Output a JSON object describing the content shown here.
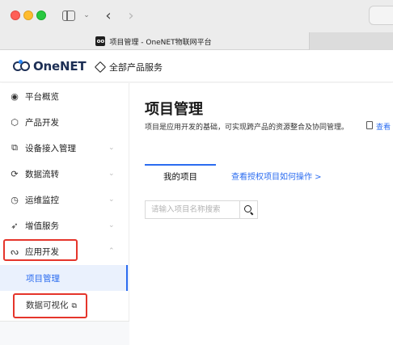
{
  "browser": {
    "tab_title": "项目管理 - OneNET物联网平台",
    "favicon_text": "oo"
  },
  "header": {
    "logo_text": "OneNET",
    "all_products": "全部产品服务"
  },
  "sidebar": {
    "items": [
      {
        "label": "平台概览",
        "icon": "overview-icon",
        "chevron": false
      },
      {
        "label": "产品开发",
        "icon": "product-cube-icon",
        "chevron": false
      },
      {
        "label": "设备接入管理",
        "icon": "device-access-icon",
        "chevron": "down"
      },
      {
        "label": "数据流转",
        "icon": "data-flow-icon",
        "chevron": "down"
      },
      {
        "label": "运维监控",
        "icon": "monitor-icon",
        "chevron": "down"
      },
      {
        "label": "增值服务",
        "icon": "value-added-icon",
        "chevron": "down"
      },
      {
        "label": "应用开发",
        "icon": "app-dev-icon",
        "chevron": "up"
      }
    ],
    "sub_items": [
      {
        "label": "项目管理",
        "active": true
      },
      {
        "label": "数据可视化",
        "external": true
      }
    ]
  },
  "main": {
    "title": "项目管理",
    "description": "项目是应用开发的基础，可实现跨产品的资源整合及协同管理。",
    "doc_link": "查看",
    "tabs": {
      "my_projects": "我的项目",
      "help_link": "查看授权项目如何操作 >"
    },
    "search": {
      "placeholder": "请输入项目名称搜索",
      "value": ""
    }
  },
  "colors": {
    "accent": "#2b6cf0",
    "highlight_box": "#e5352b",
    "brand_dark": "#1d2f55"
  }
}
